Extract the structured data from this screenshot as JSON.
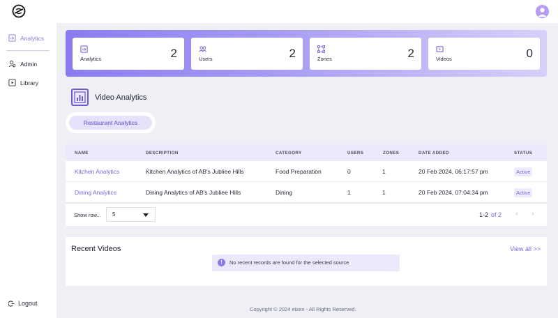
{
  "colors": {
    "accent": "#7d68e0",
    "hero_start": "#8a7cf0",
    "hero_end": "#d7d0f9",
    "page_bg": "#eef0f6"
  },
  "sidebar": {
    "items": [
      {
        "label": "Analytics",
        "icon": "chart-icon",
        "active": true
      },
      {
        "label": "Admin",
        "icon": "admin-icon",
        "active": false
      },
      {
        "label": "Library",
        "icon": "library-icon",
        "active": false
      }
    ],
    "logout_label": "Logout"
  },
  "stats": [
    {
      "label": "Analytics",
      "value": "2",
      "icon": "chart-icon"
    },
    {
      "label": "Users",
      "value": "2",
      "icon": "users-icon"
    },
    {
      "label": "Zones",
      "value": "2",
      "icon": "zones-icon"
    },
    {
      "label": "Videos",
      "value": "0",
      "icon": "video-icon"
    }
  ],
  "section_title": "Video Analytics",
  "tabs": [
    {
      "label": "Restaurant Analytics"
    }
  ],
  "table": {
    "headers": [
      "NAME",
      "DESCRIPTION",
      "CATEGORY",
      "USERS",
      "ZONES",
      "DATE ADDED",
      "STATUS"
    ],
    "rows": [
      {
        "name": "Kitchen Analytics",
        "description": "Kitchen Analytics of AB's Jubliee Hills",
        "category": "Food Preparation",
        "users": "0",
        "zones": "1",
        "date": "20 Feb 2024, 06:17:57 pm",
        "status": "Active"
      },
      {
        "name": "Dining Analytics",
        "description": "Dining Analytics of AB's Jubliee Hills",
        "category": "Dining",
        "users": "1",
        "zones": "1",
        "date": "20 Feb 2024, 07:04:34 pm",
        "status": "Active"
      }
    ],
    "pagination": {
      "show_rows_label": "Show row...",
      "rows_per_page": "5",
      "range": "1-2",
      "of": "of 2"
    }
  },
  "recent": {
    "title": "Recent Videos",
    "view_all": "View all >>",
    "empty_message": "No recent records are found for the selected source"
  },
  "footer": "Copyright © 2024 eizen - All Rights Reserved."
}
